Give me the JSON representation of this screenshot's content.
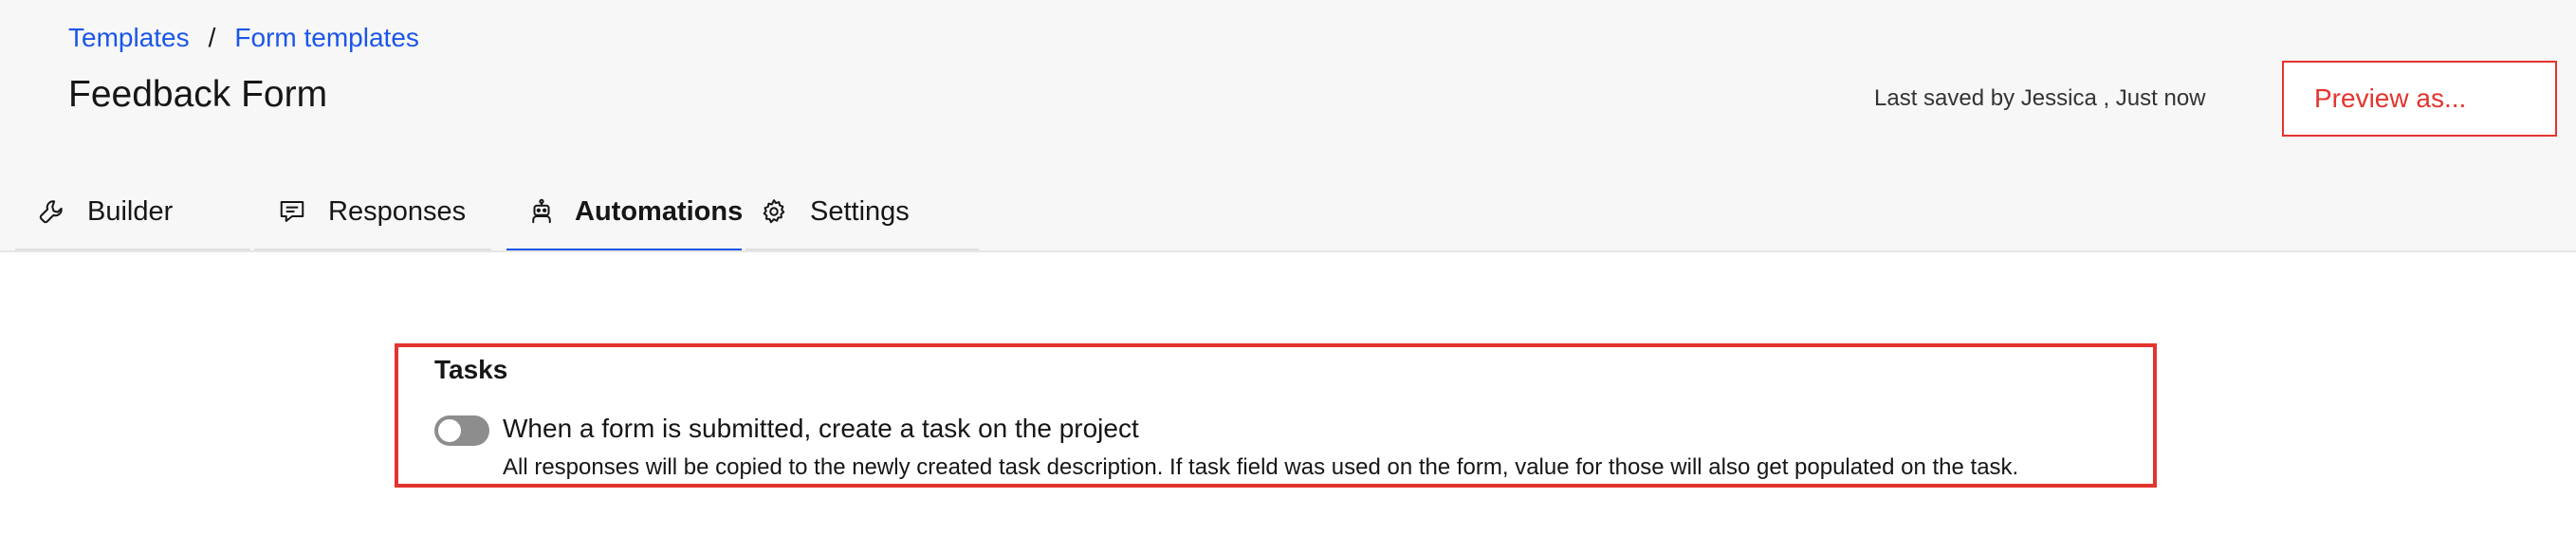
{
  "breadcrumb": {
    "items": [
      "Templates",
      "Form templates"
    ],
    "separator": "/"
  },
  "page": {
    "title": "Feedback Form",
    "last_saved": "Last saved by Jessica , Just now",
    "preview_button": "Preview as..."
  },
  "tabs": [
    {
      "label": "Builder",
      "icon": "wrench-icon",
      "active": false
    },
    {
      "label": "Responses",
      "icon": "chat-icon",
      "active": false
    },
    {
      "label": "Automations",
      "icon": "robot-icon",
      "active": true
    },
    {
      "label": "Settings",
      "icon": "gear-icon",
      "active": false
    }
  ],
  "tasks": {
    "title": "Tasks",
    "toggle_on": false,
    "toggle_label": "When a form is submitted, create a task on the project",
    "description": "All responses will be copied to the newly created task description. If task field was used on the form, value for those will also get populated on the task."
  },
  "colors": {
    "link": "#1a56e8",
    "accent_red": "#e3342f",
    "active_tab_underline": "#1a56e8",
    "header_bg": "#f7f7f7"
  }
}
